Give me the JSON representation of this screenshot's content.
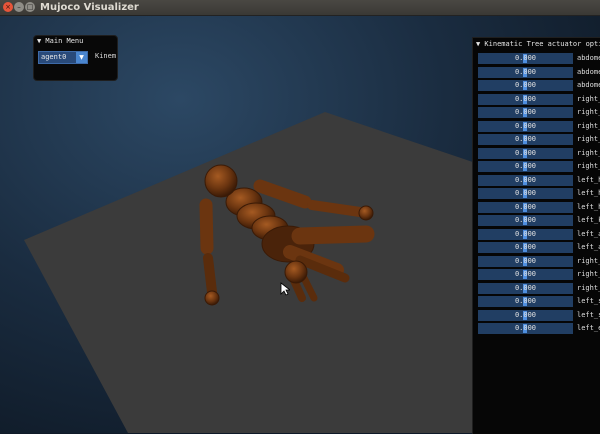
{
  "window": {
    "title": "Mujoco Visualizer"
  },
  "main_menu": {
    "header": "▼ Main Menu",
    "selected_agent": "agent0",
    "side_label": "Kinem"
  },
  "actuator_panel": {
    "header": "▼ Kinematic Tree actuator opti",
    "rows": [
      {
        "value": "0.000",
        "label": "abdome"
      },
      {
        "value": "0.000",
        "label": "abdome"
      },
      {
        "value": "0.000",
        "label": "abdome"
      },
      {
        "value": "0.000",
        "label": "right_"
      },
      {
        "value": "0.000",
        "label": "right_"
      },
      {
        "value": "0.000",
        "label": "right_"
      },
      {
        "value": "0.000",
        "label": "right_"
      },
      {
        "value": "0.000",
        "label": "right_"
      },
      {
        "value": "0.000",
        "label": "right_"
      },
      {
        "value": "0.000",
        "label": "left_h"
      },
      {
        "value": "0.000",
        "label": "left_h"
      },
      {
        "value": "0.000",
        "label": "left_h"
      },
      {
        "value": "0.000",
        "label": "left_k"
      },
      {
        "value": "0.000",
        "label": "left_a"
      },
      {
        "value": "0.000",
        "label": "left_a"
      },
      {
        "value": "0.000",
        "label": "right_"
      },
      {
        "value": "0.000",
        "label": "right_"
      },
      {
        "value": "0.000",
        "label": "right_"
      },
      {
        "value": "0.000",
        "label": "left_s"
      },
      {
        "value": "0.000",
        "label": "left_s"
      },
      {
        "value": "0.000",
        "label": "left_e"
      }
    ]
  },
  "colors": {
    "accent": "#4f8fe0",
    "slider_bg": "#213e63",
    "body_color": "#6b3510",
    "floor": "#3b3b3b"
  }
}
